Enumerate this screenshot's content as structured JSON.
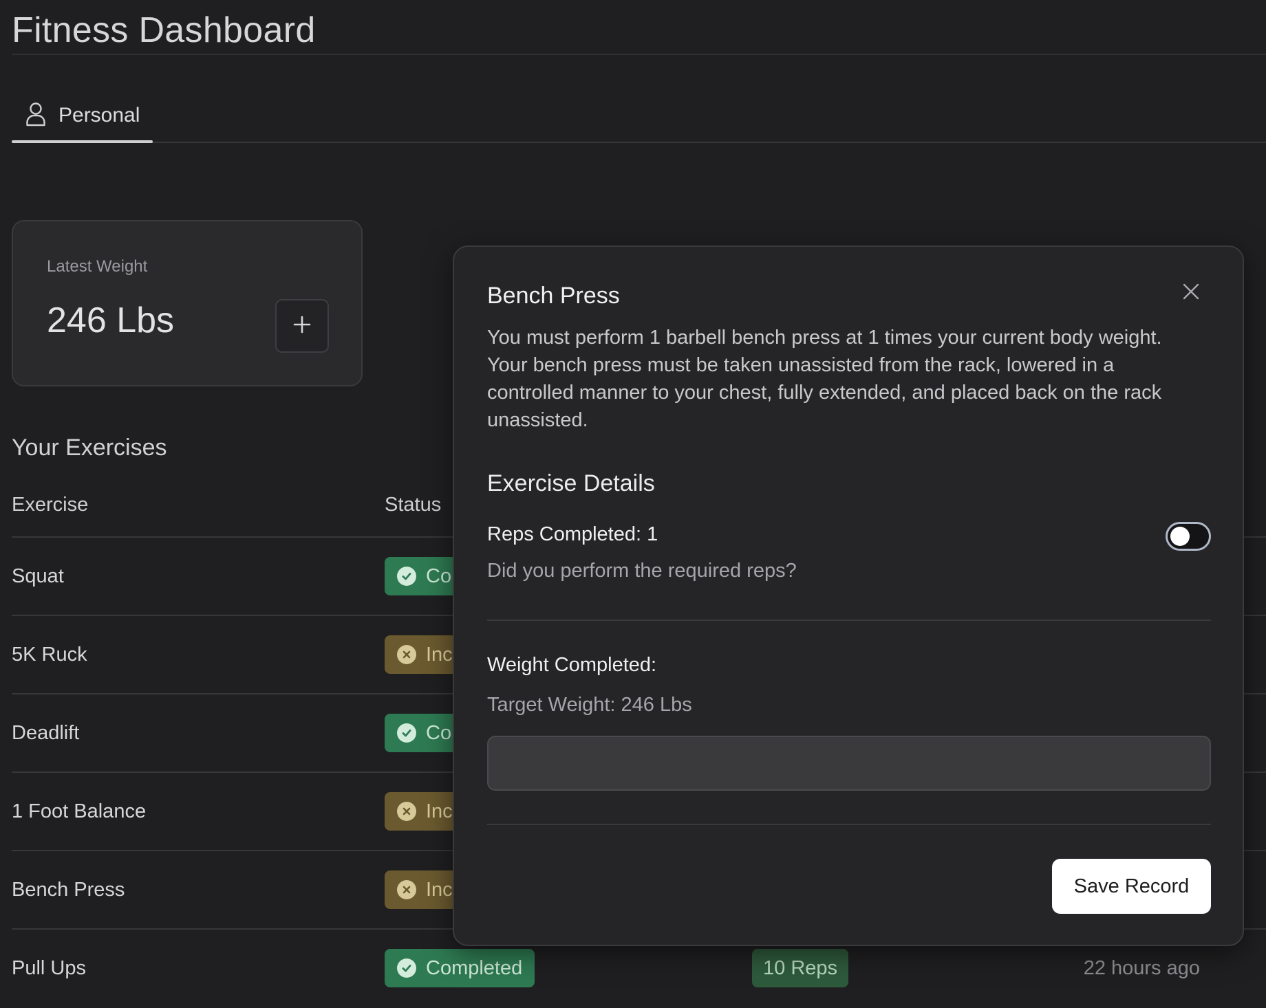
{
  "header": {
    "title": "Fitness Dashboard"
  },
  "tabs": [
    {
      "label": "Personal",
      "icon": "user-icon",
      "active": true
    }
  ],
  "weight_card": {
    "label": "Latest Weight",
    "value": "246 Lbs",
    "add_icon": "plus-icon"
  },
  "exercises": {
    "title": "Your Exercises",
    "columns": [
      "Exercise",
      "Status"
    ],
    "rows": [
      {
        "name": "Squat",
        "status": "Co",
        "status_type": "complete"
      },
      {
        "name": "5K Ruck",
        "status": "Inc",
        "status_type": "incomplete"
      },
      {
        "name": "Deadlift",
        "status": "Co",
        "status_type": "complete"
      },
      {
        "name": "1 Foot Balance",
        "status": "Inc",
        "status_type": "incomplete"
      },
      {
        "name": "Bench Press",
        "status": "Inc",
        "status_type": "incomplete"
      },
      {
        "name": "Pull Ups",
        "status": "Completed",
        "status_type": "complete",
        "reps": "10 Reps",
        "time": "22 hours ago"
      }
    ]
  },
  "modal": {
    "title": "Bench Press",
    "description": "You must perform 1 barbell bench press at 1 times your current body weight. Your bench press must be taken unassisted from the rack, lowered in a controlled manner to your chest, fully extended, and placed back on the rack unassisted.",
    "details_title": "Exercise Details",
    "reps_label": "Reps Completed: 1",
    "reps_question": "Did you perform the required reps?",
    "reps_toggle_on": false,
    "weight_label": "Weight Completed:",
    "target_weight": "Target Weight: 246 Lbs",
    "weight_input_value": "",
    "save_label": "Save Record",
    "close_icon": "close-icon"
  },
  "colors": {
    "background": "#1f1f21",
    "complete_badge": "#2e7a52",
    "incomplete_badge": "#6b5a2f",
    "modal_bg": "#252527",
    "primary_button": "#ffffff"
  }
}
